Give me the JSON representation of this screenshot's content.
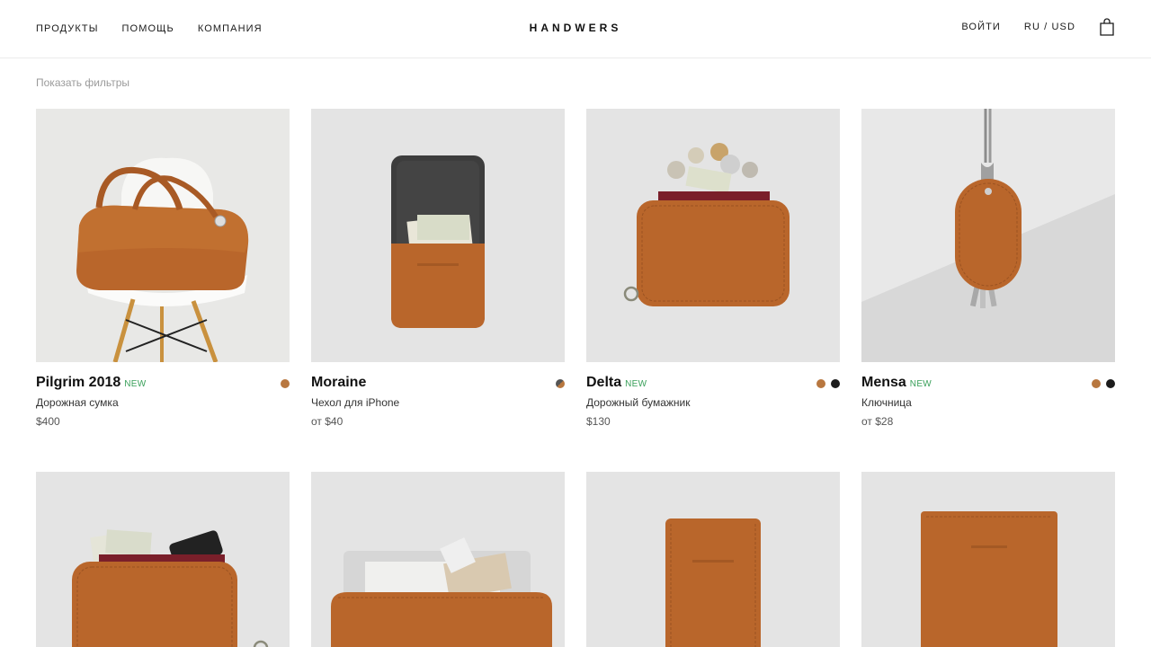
{
  "nav": {
    "products": "ПРОДУКТЫ",
    "help": "ПОМОЩЬ",
    "company": "КОМПАНИЯ",
    "login": "ВОЙТИ",
    "locale": "RU / USD",
    "cart_icon": "shopping-bag-icon"
  },
  "brand": {
    "logo": "HANDWERS"
  },
  "filters": {
    "label": "Показать фильтры"
  },
  "colors": {
    "tan": "#b8773f",
    "black": "#1c1c1c",
    "new_badge": "#3aa05a",
    "leather": "#b9662b",
    "photo_bg": "#e4e4e4"
  },
  "products": [
    {
      "name": "Pilgrim 2018",
      "badge": "NEW",
      "description": "Дорожная сумка",
      "price": "$400",
      "swatches": [
        "#b8773f"
      ]
    },
    {
      "name": "Moraine",
      "badge": "",
      "description": "Чехол для iPhone",
      "price": "от $40",
      "swatches": [
        "split-tan-gray"
      ]
    },
    {
      "name": "Delta",
      "badge": "NEW",
      "description": "Дорожный бумажник",
      "price": "$130",
      "swatches": [
        "#b8773f",
        "#1c1c1c"
      ]
    },
    {
      "name": "Mensa",
      "badge": "NEW",
      "description": "Ключница",
      "price": "от $28",
      "swatches": [
        "#b8773f",
        "#1c1c1c"
      ]
    }
  ]
}
